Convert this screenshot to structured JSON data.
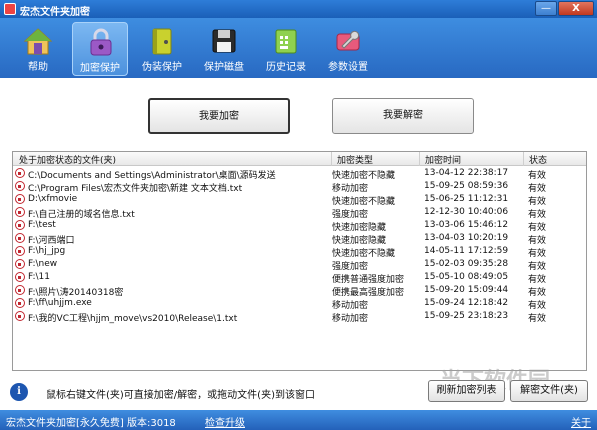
{
  "window": {
    "title": "宏杰文件夹加密",
    "min_label": "—",
    "close_label": "X"
  },
  "toolbar": {
    "items": [
      {
        "label": "帮助",
        "icon": "home-icon"
      },
      {
        "label": "加密保护",
        "icon": "lock-icon"
      },
      {
        "label": "伪装保护",
        "icon": "notebook-icon"
      },
      {
        "label": "保护磁盘",
        "icon": "disk-icon"
      },
      {
        "label": "历史记录",
        "icon": "history-icon"
      },
      {
        "label": "参数设置",
        "icon": "wrench-icon"
      }
    ],
    "active_index": 1
  },
  "actions": {
    "encrypt_label": "我要加密",
    "decrypt_label": "我要解密"
  },
  "list": {
    "columns": [
      "处于加密状态的文件(夹)",
      "加密类型",
      "加密时间",
      "状态"
    ],
    "rows": [
      {
        "path": "C:\\Documents and Settings\\Administrator\\桌面\\源码发送",
        "type": "快速加密不隐藏",
        "time": "13-04-12 22:38:17",
        "status": "有效"
      },
      {
        "path": "C:\\Program Files\\宏杰文件夹加密\\新建 文本文档.txt",
        "type": "移动加密",
        "time": "15-09-25 08:59:36",
        "status": "有效"
      },
      {
        "path": "D:\\xfmovie",
        "type": "快速加密不隐藏",
        "time": "15-06-25 11:12:31",
        "status": "有效"
      },
      {
        "path": "F:\\自己注册的域名信息.txt",
        "type": "强度加密",
        "time": "12-12-30 10:40:06",
        "status": "有效"
      },
      {
        "path": "F:\\test",
        "type": "快速加密隐藏",
        "time": "13-03-06 15:46:12",
        "status": "有效"
      },
      {
        "path": "F:\\河西端口",
        "type": "快速加密隐藏",
        "time": "13-04-03 10:20:19",
        "status": "有效"
      },
      {
        "path": "F:\\hj_jpg",
        "type": "快速加密不隐藏",
        "time": "14-05-11 17:12:59",
        "status": "有效"
      },
      {
        "path": "F:\\new",
        "type": "强度加密",
        "time": "15-02-03 09:35:28",
        "status": "有效"
      },
      {
        "path": "F:\\11",
        "type": "便携普通强度加密",
        "time": "15-05-10 08:49:05",
        "status": "有效"
      },
      {
        "path": "F:\\照片\\涛20140318密",
        "type": "便携最高强度加密",
        "time": "15-09-20 15:09:44",
        "status": "有效"
      },
      {
        "path": "F:\\ff\\uhjjm.exe",
        "type": "移动加密",
        "time": "15-09-24 12:18:42",
        "status": "有效"
      },
      {
        "path": "F:\\我的VC工程\\hjjm_move\\vs2010\\Release\\1.txt",
        "type": "移动加密",
        "time": "15-09-25 23:18:23",
        "status": "有效"
      }
    ]
  },
  "hint": {
    "icon": "info-icon",
    "text": "鼠标右键文件(夹)可直接加密/解密，或拖动文件(夹)到该窗口"
  },
  "bottom_buttons": {
    "refresh_label": "刷新加密列表",
    "decrypt_file_label": "解密文件(夹)"
  },
  "watermark": "当下软件园",
  "statusbar": {
    "version_text": "宏杰文件夹加密[永久免费]  版本:3018",
    "check_update": "检查升级",
    "about": "关于"
  }
}
